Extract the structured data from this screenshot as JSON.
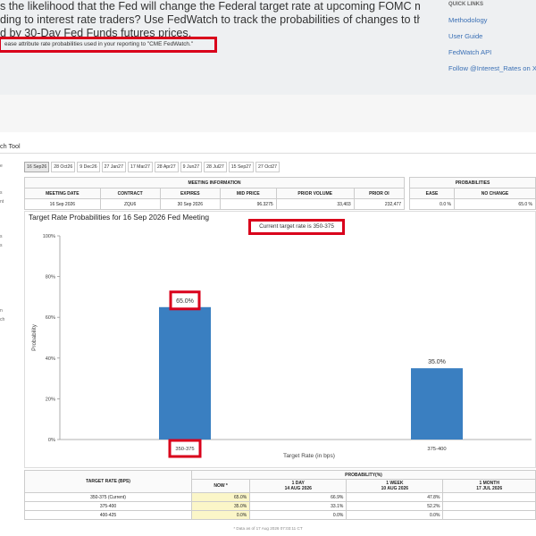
{
  "intro": {
    "lines": [
      "s the likelihood that the Fed will change the Federal target rate at upcoming FOMC meetings,",
      "ding to interest rate traders? Use FedWatch to track the probabilities of changes to the Fed rate, as",
      "d by 30-Day Fed Funds futures prices."
    ],
    "attribution": "ease attribute rate probabilities used in your reporting to \"CME FedWatch.\""
  },
  "quick_links": {
    "title": "QUICK LINKS",
    "items": [
      "Methodology",
      "User Guide",
      "FedWatch API",
      "Follow @Interest_Rates on X"
    ]
  },
  "tool_title": "ch Tool",
  "sidebar_fragments": [
    "e",
    "s",
    "nt",
    "s",
    "s",
    "n",
    "ch"
  ],
  "tabs": [
    "16 Sep26",
    "28 Oct26",
    "9 Dec26",
    "27 Jan27",
    "17 Mar27",
    "28 Apr27",
    "9 Jun27",
    "28 Jul27",
    "15 Sep27",
    "27 Oct27"
  ],
  "meeting_info": {
    "title": "MEETING INFORMATION",
    "headers": [
      "MEETING DATE",
      "CONTRACT",
      "EXPIRES",
      "MID PRICE",
      "PRIOR VOLUME",
      "PRIOR OI"
    ],
    "row": [
      "16 Sep 2026",
      "ZQU6",
      "30 Sep 2026",
      "96.3275",
      "33,403",
      "232,477"
    ]
  },
  "probabilities": {
    "title": "PROBABILITIES",
    "headers": [
      "EASE",
      "NO CHANGE"
    ],
    "row": [
      "0.0 %",
      "65.0 %"
    ]
  },
  "current_target": "Current target rate is 350-375",
  "chart_data": {
    "type": "bar",
    "title": "Target Rate Probabilities for 16 Sep 2026 Fed Meeting",
    "xlabel": "Target Rate (in bps)",
    "ylabel": "Probability",
    "categories": [
      "350-375",
      "375-400"
    ],
    "values": [
      65.0,
      35.0
    ],
    "value_labels": [
      "65.0%",
      "35.0%"
    ],
    "yticks": [
      "0%",
      "20%",
      "40%",
      "60%",
      "80%",
      "100%"
    ],
    "ylim": [
      0,
      100
    ],
    "bar_color": "#3a7fc1",
    "grid": false
  },
  "bottom_table": {
    "header_rate": "TARGET RATE (BPS)",
    "header_prob": "PROBABILITY(%)",
    "columns": [
      {
        "line1": "NOW *",
        "line2": ""
      },
      {
        "line1": "1 DAY",
        "line2": "14 AUG 2026"
      },
      {
        "line1": "1 WEEK",
        "line2": "10 AUG 2026"
      },
      {
        "line1": "1 MONTH",
        "line2": "17 JUL 2026"
      }
    ],
    "rows": [
      {
        "rate": "350-375 (Current)",
        "vals": [
          "65.0%",
          "66.9%",
          "47.8%",
          ""
        ]
      },
      {
        "rate": "375-400",
        "vals": [
          "35.0%",
          "33.1%",
          "52.2%",
          ""
        ]
      },
      {
        "rate": "400-425",
        "vals": [
          "0.0%",
          "0.0%",
          "0.0%",
          ""
        ]
      }
    ]
  },
  "footnote": "* Data as of 17 Aug 2026 07:03:11 CT",
  "colors": {
    "highlight": "#d9001b",
    "link": "#3b70b5"
  }
}
